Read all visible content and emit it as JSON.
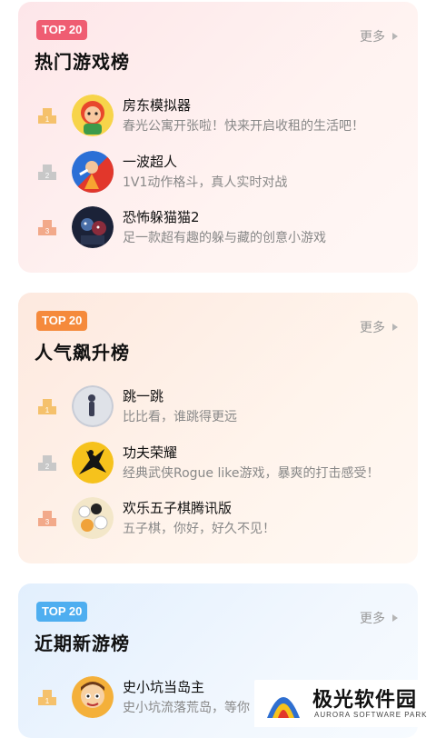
{
  "sections": [
    {
      "badge": "TOP 20",
      "title": "热门游戏榜",
      "more": "更多",
      "items": [
        {
          "rank": "1",
          "name": "房东模拟器",
          "desc": "春光公寓开张啦！快来开启收租的生活吧！"
        },
        {
          "rank": "2",
          "name": "一波超人",
          "desc": "1V1动作格斗，真人实时对战"
        },
        {
          "rank": "3",
          "name": "恐怖躲猫猫2",
          "desc": "足一款超有趣的躲与藏的创意小游戏"
        }
      ]
    },
    {
      "badge": "TOP 20",
      "title": "人气飙升榜",
      "more": "更多",
      "items": [
        {
          "rank": "1",
          "name": "跳一跳",
          "desc": "比比看，谁跳得更远"
        },
        {
          "rank": "2",
          "name": "功夫荣耀",
          "desc": "经典武侠Rogue like游戏，暴爽的打击感受！"
        },
        {
          "rank": "3",
          "name": "欢乐五子棋腾讯版",
          "desc": "五子棋，你好，好久不见！"
        }
      ]
    },
    {
      "badge": "TOP 20",
      "title": "近期新游榜",
      "more": "更多",
      "items": [
        {
          "rank": "1",
          "name": "史小坑当岛主",
          "desc": "史小坑流落荒岛，等你"
        }
      ]
    }
  ],
  "watermark": {
    "text": "极光软件园",
    "sub": "AURORA SOFTWARE PARK"
  },
  "colors": {
    "gold": "#f5c16c",
    "silver": "#c8c8c8",
    "bronze": "#f2a98a"
  }
}
